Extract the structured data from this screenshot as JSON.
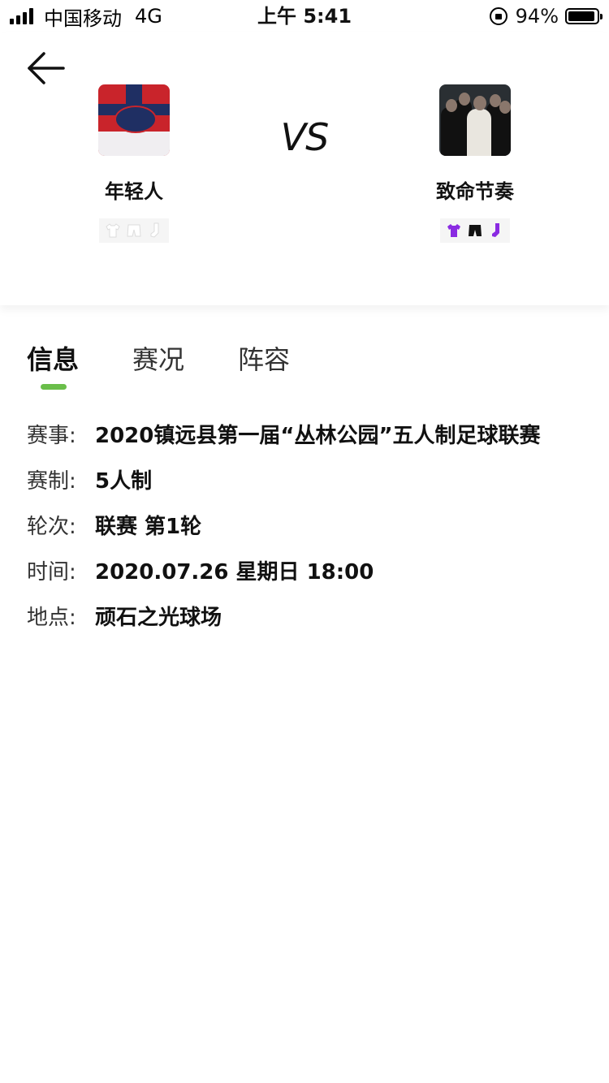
{
  "status_bar": {
    "carrier": "中国移动",
    "network": "4G",
    "time": "上午 5:41",
    "battery": "94%",
    "battery_level": 0.94
  },
  "match": {
    "vs_label": "VS",
    "home": {
      "name": "年轻人",
      "kit_colors": {
        "shirt": "#ffffff",
        "shorts": "#ffffff",
        "socks": "#ffffff"
      }
    },
    "away": {
      "name": "致命节奏",
      "kit_colors": {
        "shirt": "#8a2be2",
        "shorts": "#111111",
        "socks": "#8a2be2"
      }
    }
  },
  "tabs": [
    {
      "label": "信息",
      "active": true
    },
    {
      "label": "赛况",
      "active": false
    },
    {
      "label": "阵容",
      "active": false
    }
  ],
  "accent_color": "#6abe4a",
  "info": [
    {
      "label": "赛事:",
      "value": "2020镇远县第一届“丛林公园”五人制足球联赛"
    },
    {
      "label": "赛制:",
      "value": "5人制"
    },
    {
      "label": "轮次:",
      "value": "联赛 第1轮"
    },
    {
      "label": "时间:",
      "value": "2020.07.26 星期日 18:00"
    },
    {
      "label": "地点:",
      "value": "顽石之光球场"
    }
  ]
}
